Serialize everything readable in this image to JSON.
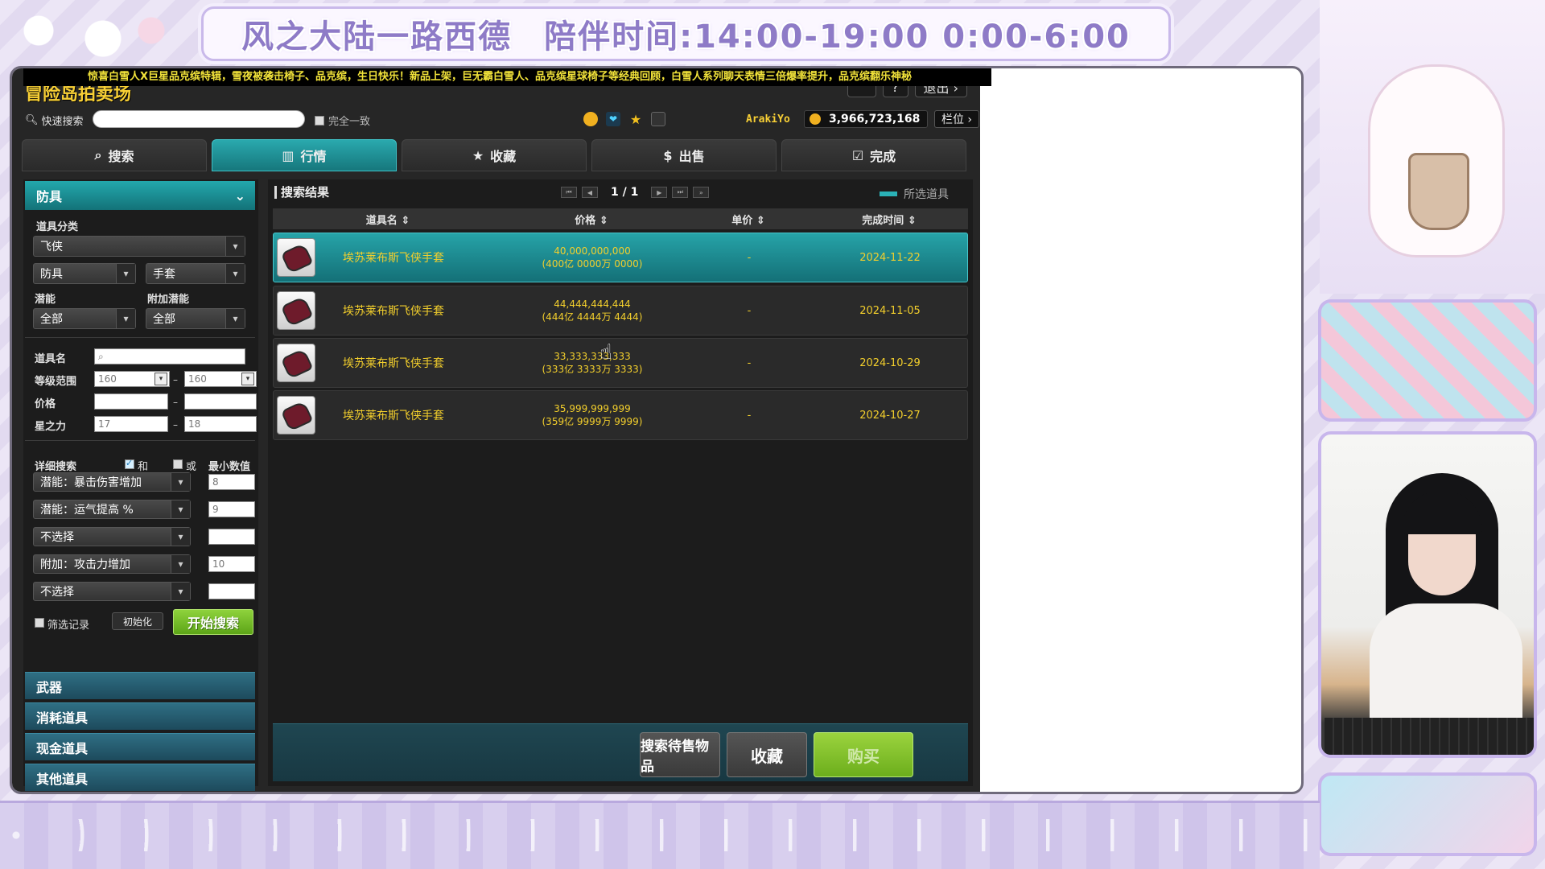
{
  "overlay": {
    "banner_title": "风之大陆一路西德",
    "banner_schedule": "陪伴时间:14:00-19:00 0:00-6:00"
  },
  "ticker": "惊喜白雪人X巨星品克缤特辑，雪夜被袭击椅子、品克缤，生日快乐！新品上架，巨无霸白雪人、品克缤星球椅子等经典回顾，白雪人系列聊天表情三倍爆率提升，品克缤翻乐神秘",
  "auction": {
    "title": "冒险岛拍卖场",
    "top_buttons": {
      "icon1": "⌃",
      "icon2": "?",
      "exit": "退出 ›"
    },
    "quick_search": {
      "label": "快速搜索",
      "value": "",
      "exact_label": "完全一致"
    },
    "user": {
      "name": "ArakiYo",
      "meso": "3,966,723,168",
      "slot_button": "栏位 ›"
    },
    "tabs": [
      {
        "label": "搜索",
        "icon": "search-icon"
      },
      {
        "label": "行情",
        "icon": "bar-chart-icon"
      },
      {
        "label": "收藏",
        "icon": "star-icon"
      },
      {
        "label": "出售",
        "icon": "coin-icon"
      },
      {
        "label": "完成",
        "icon": "check-icon"
      }
    ],
    "active_tab": "行情",
    "left": {
      "category": "防具",
      "item_category_label": "道具分类",
      "class_value": "飞侠",
      "type_value": "防具",
      "subtype_value": "手套",
      "potential_label": "潜能",
      "bonus_potential_label": "附加潜能",
      "potential_value": "全部",
      "bonus_potential_value": "全部",
      "item_name_label": "道具名",
      "item_name_value": "",
      "level_range_label": "等级范围",
      "level_min": "160",
      "level_max": "160",
      "price_label": "价格",
      "price_min": "",
      "price_max": "",
      "star_label": "星之力",
      "star_min": "17",
      "star_max": "18",
      "detail_search_label": "详细搜索",
      "and_label": "和",
      "or_label": "或",
      "min_value_label": "最小数值",
      "options": [
        {
          "label": "潜能：暴击伤害增加",
          "value": "8"
        },
        {
          "label": "潜能：运气提高 %",
          "value": "9"
        },
        {
          "label": "不选择",
          "value": ""
        },
        {
          "label": "附加：攻击力增加",
          "value": "10"
        },
        {
          "label": "不选择",
          "value": ""
        }
      ],
      "filter_record_label": "筛选记录",
      "reset_label": "初始化",
      "start_label": "开始搜索",
      "other_categories": [
        "武器",
        "消耗道具",
        "现金道具",
        "其他道具"
      ]
    },
    "results": {
      "title": "搜索结果",
      "page": "1 / 1",
      "legend": "所选道具",
      "columns": {
        "name": "道具名",
        "price": "价格",
        "unit": "单价",
        "date": "完成时间"
      },
      "rows": [
        {
          "name": "埃苏莱布斯飞侠手套",
          "price": "40,000,000,000",
          "price_sub": "(400亿 0000万 0000)",
          "unit": "-",
          "date": "2024-11-22"
        },
        {
          "name": "埃苏莱布斯飞侠手套",
          "price": "44,444,444,444",
          "price_sub": "(444亿 4444万 4444)",
          "unit": "-",
          "date": "2024-11-05"
        },
        {
          "name": "埃苏莱布斯飞侠手套",
          "price": "33,333,333,333",
          "price_sub": "(333亿 3333万 3333)",
          "unit": "-",
          "date": "2024-10-29"
        },
        {
          "name": "埃苏莱布斯飞侠手套",
          "price": "35,999,999,999",
          "price_sub": "(359亿 9999万 9999)",
          "unit": "-",
          "date": "2024-10-27"
        }
      ],
      "footer": {
        "search_pending": "搜索待售物品",
        "favorite": "收藏",
        "buy": "购买"
      }
    }
  },
  "colors": {
    "accent_teal": "#1f9ea3",
    "gold_text": "#f3cf2c",
    "buy_green": "#7cbf26"
  }
}
